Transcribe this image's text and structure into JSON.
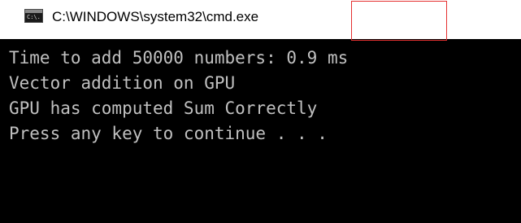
{
  "window": {
    "title": "C:\\WINDOWS\\system32\\cmd.exe",
    "icon": "command-prompt-icon",
    "icon_glyph": "C:\\.",
    "console_background": "#000000",
    "console_text_color": "#c0c0c0"
  },
  "console": {
    "lines": [
      {
        "prefix": "Time to add 50000 numbers: ",
        "value": "0.9 ms"
      },
      {
        "text": "Vector addition on GPU"
      },
      {
        "text": "GPU has computed Sum Correctly"
      },
      {
        "text": "Press any key to continue . . ."
      }
    ]
  },
  "annotation": {
    "highlight_color": "#e53030",
    "highlighted_value": "0.9 ms"
  }
}
